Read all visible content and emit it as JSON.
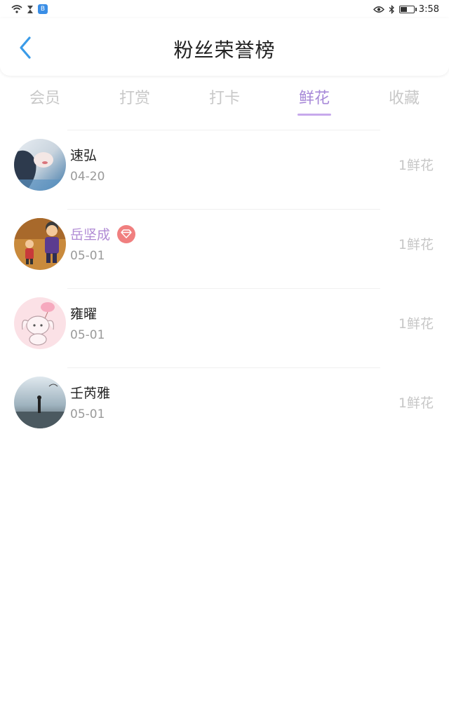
{
  "status_bar": {
    "app_badge": "B",
    "time": "3:58",
    "battery_level": 0.55
  },
  "header": {
    "title": "粉丝荣誉榜"
  },
  "tabs": [
    {
      "label": "会员",
      "active": false
    },
    {
      "label": "打赏",
      "active": false
    },
    {
      "label": "打卡",
      "active": false
    },
    {
      "label": "鲜花",
      "active": true
    },
    {
      "label": "收藏",
      "active": false
    }
  ],
  "fans": [
    {
      "name": "速弘",
      "date": "04-20",
      "amount": "1鲜花",
      "vip": false,
      "avatar": "avatar-1"
    },
    {
      "name": "岳坚成",
      "date": "05-01",
      "amount": "1鲜花",
      "vip": true,
      "avatar": "avatar-2"
    },
    {
      "name": "雍曜",
      "date": "05-01",
      "amount": "1鲜花",
      "vip": false,
      "avatar": "avatar-3"
    },
    {
      "name": "壬芮雅",
      "date": "05-01",
      "amount": "1鲜花",
      "vip": false,
      "avatar": "avatar-4"
    }
  ],
  "colors": {
    "accent": "#a789d8",
    "tab_inactive": "#c8c8c8",
    "back_arrow": "#3a9be8",
    "vip_name": "#b08ad4",
    "vip_badge": "#f07f7f"
  }
}
